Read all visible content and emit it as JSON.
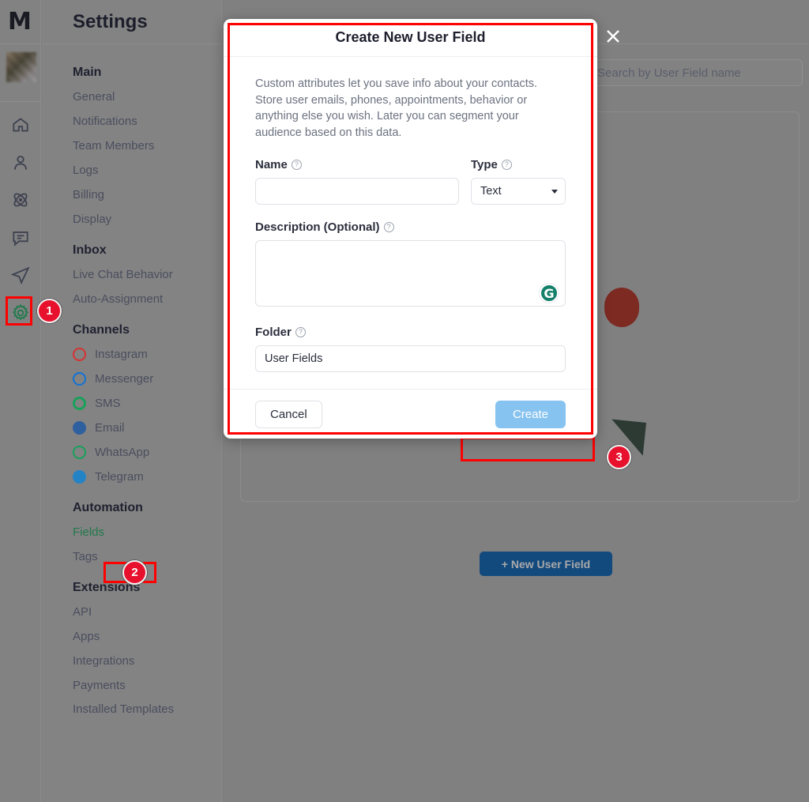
{
  "app": {
    "logo_text": "M",
    "page_title": "Settings"
  },
  "icon_rail": {
    "items": [
      {
        "name": "home-icon",
        "label": "Home"
      },
      {
        "name": "contacts-icon",
        "label": "Contacts"
      },
      {
        "name": "automation-icon",
        "label": "Automation"
      },
      {
        "name": "live-chat-icon",
        "label": "Live Chat"
      },
      {
        "name": "broadcast-icon",
        "label": "Broadcast"
      },
      {
        "name": "settings-gear-icon",
        "label": "Settings"
      }
    ]
  },
  "sidebar": {
    "groups": [
      {
        "title": "Main",
        "items": [
          {
            "label": "General"
          },
          {
            "label": "Notifications"
          },
          {
            "label": "Team Members"
          },
          {
            "label": "Logs"
          },
          {
            "label": "Billing"
          },
          {
            "label": "Display"
          }
        ]
      },
      {
        "title": "Inbox",
        "items": [
          {
            "label": "Live Chat Behavior"
          },
          {
            "label": "Auto-Assignment"
          }
        ]
      },
      {
        "title": "Channels",
        "items": [
          {
            "label": "Instagram",
            "icon": "instagram-icon",
            "color": "#d63333"
          },
          {
            "label": "Messenger",
            "icon": "messenger-icon",
            "color": "#1272d4"
          },
          {
            "label": "SMS",
            "icon": "sms-icon",
            "color": "#19a05a"
          },
          {
            "label": "Email",
            "icon": "email-icon",
            "color": "#2e5f9e"
          },
          {
            "label": "WhatsApp",
            "icon": "whatsapp-icon",
            "color": "#19a05a"
          },
          {
            "label": "Telegram",
            "icon": "telegram-icon",
            "color": "#2483c5"
          }
        ]
      },
      {
        "title": "Automation",
        "items": [
          {
            "label": "Fields",
            "selected": true
          },
          {
            "label": "Tags"
          }
        ]
      },
      {
        "title": "Extensions",
        "items": [
          {
            "label": "API"
          },
          {
            "label": "Apps"
          },
          {
            "label": "Integrations"
          },
          {
            "label": "Payments"
          },
          {
            "label": "Installed Templates"
          }
        ]
      }
    ]
  },
  "content": {
    "search_placeholder": "Search by User Field name",
    "new_field_button": "+ New User Field"
  },
  "modal": {
    "title": "Create New User Field",
    "description": "Custom attributes let you save info about your contacts. Store user emails, phones, appointments, behavior or anything else you wish. Later you can segment your audience based on this data.",
    "name_label": "Name",
    "name_value": "",
    "name_placeholder": "",
    "type_label": "Type",
    "type_value": "Text",
    "type_options": [
      "Text"
    ],
    "description_label": "Description (Optional)",
    "description_value": "",
    "description_placeholder": "",
    "grammarly_badge": "G",
    "folder_label": "Folder",
    "folder_value": "User Fields",
    "cancel_label": "Cancel",
    "create_label": "Create",
    "close_icon": "close-icon",
    "help_icon": "?"
  },
  "annotations": {
    "badges": [
      {
        "number": "1",
        "target": "settings-gear-icon"
      },
      {
        "number": "2",
        "target": "sidebar-item-fields"
      },
      {
        "number": "3",
        "target": "new-user-field-button"
      }
    ],
    "highlight_color": "#ff0000"
  }
}
